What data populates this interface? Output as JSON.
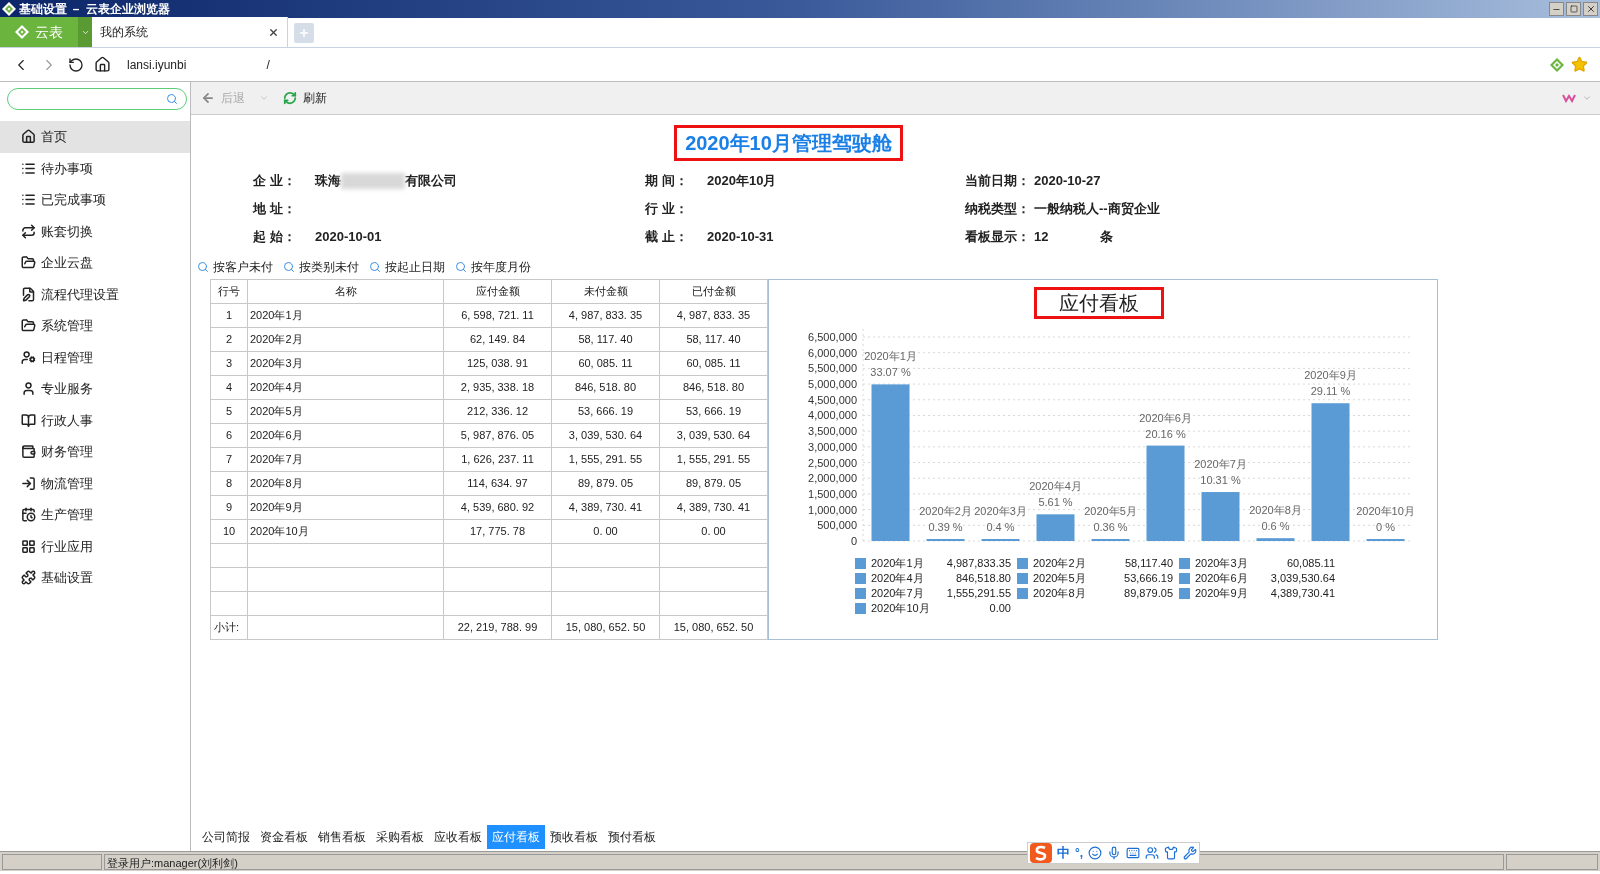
{
  "window": {
    "title": "基础设置 － 云表企业浏览器"
  },
  "browser": {
    "brand_button": "云表",
    "tabs": [
      {
        "label": "我的系统",
        "selected": true
      }
    ],
    "url_start": "lansi.iyunbi",
    "url_end": "/"
  },
  "toolbar": {
    "items": [
      {
        "label": "后退",
        "disabled": true,
        "kind": "back"
      },
      {
        "label": "刷新",
        "disabled": false,
        "kind": "refresh"
      }
    ]
  },
  "sidebar": {
    "items": [
      {
        "label": "首页",
        "selected": true,
        "kind": "home"
      },
      {
        "label": "待办事项",
        "selected": false,
        "kind": "list"
      },
      {
        "label": "已完成事项",
        "selected": false,
        "kind": "list"
      },
      {
        "label": "账套切换",
        "selected": false,
        "kind": "switch"
      },
      {
        "label": "企业云盘",
        "selected": false,
        "kind": "folder"
      },
      {
        "label": "流程代理设置",
        "selected": false,
        "kind": "edit"
      },
      {
        "label": "系统管理",
        "selected": false,
        "kind": "folder"
      },
      {
        "label": "日程管理",
        "selected": false,
        "kind": "usercard"
      },
      {
        "label": "专业服务",
        "selected": false,
        "kind": "user"
      },
      {
        "label": "行政人事",
        "selected": false,
        "kind": "book"
      },
      {
        "label": "财务管理",
        "selected": false,
        "kind": "wallet"
      },
      {
        "label": "物流管理",
        "selected": false,
        "kind": "login"
      },
      {
        "label": "生产管理",
        "selected": false,
        "kind": "clock"
      },
      {
        "label": "行业应用",
        "selected": false,
        "kind": "grid"
      },
      {
        "label": "基础设置",
        "selected": false,
        "kind": "puzzle"
      }
    ]
  },
  "page": {
    "title": "2020年10月管理驾驶舱",
    "info": [
      {
        "label": "企 业：",
        "value": "珠海",
        "value_after_redaction": "有限公司"
      },
      {
        "label": "期 间：",
        "value": "2020年10月"
      },
      {
        "label": "当前日期：",
        "value": "2020-10-27"
      },
      {
        "label": "地 址："
      },
      {
        "label": "行 业："
      },
      {
        "label": "纳税类型：",
        "value": "一般纳税人--商贸企业"
      },
      {
        "label": "起 始：",
        "value": "2020-10-01"
      },
      {
        "label": "截 止：",
        "value": "2020-10-31"
      },
      {
        "label": "看板显示：",
        "value": "12",
        "unit": "条"
      }
    ],
    "filters": [
      "按客户未付",
      "按类别未付",
      "按起止日期",
      "按年度月份"
    ],
    "table": {
      "columns": [
        "行号",
        "名称",
        "应付金额",
        "未付金额",
        "已付金额"
      ],
      "rows": [
        [
          "1",
          "2020年1月",
          "6, 598, 721. 11",
          "4, 987, 833. 35",
          "4, 987, 833. 35"
        ],
        [
          "2",
          "2020年2月",
          "62, 149. 84",
          "58, 117. 40",
          "58, 117. 40"
        ],
        [
          "3",
          "2020年3月",
          "125, 038. 91",
          "60, 085. 11",
          "60, 085. 11"
        ],
        [
          "4",
          "2020年4月",
          "2, 935, 338. 18",
          "846, 518. 80",
          "846, 518. 80"
        ],
        [
          "5",
          "2020年5月",
          "212, 336. 12",
          "53, 666. 19",
          "53, 666. 19"
        ],
        [
          "6",
          "2020年6月",
          "5, 987, 876. 05",
          "3, 039, 530. 64",
          "3, 039, 530. 64"
        ],
        [
          "7",
          "2020年7月",
          "1, 626, 237. 11",
          "1, 555, 291. 55",
          "1, 555, 291. 55"
        ],
        [
          "8",
          "2020年8月",
          "114, 634. 97",
          "89, 879. 05",
          "89, 879. 05"
        ],
        [
          "9",
          "2020年9月",
          "4, 539, 680. 92",
          "4, 389, 730. 41",
          "4, 389, 730. 41"
        ],
        [
          "10",
          "2020年10月",
          "17, 775. 78",
          "0. 00",
          "0. 00"
        ]
      ],
      "total": {
        "label": "小计:",
        "values": [
          "22, 219, 788. 99",
          "15, 080, 652. 50",
          "15, 080, 652. 50"
        ]
      }
    },
    "chart": {
      "title": "应付看板",
      "chart_data": {
        "type": "bar",
        "categories": [
          "2020年1月",
          "2020年2月",
          "2020年3月",
          "2020年4月",
          "2020年5月",
          "2020年6月",
          "2020年7月",
          "2020年8月",
          "2020年9月",
          "2020年10月"
        ],
        "series": [
          {
            "color": "#5b9bd5",
            "values": [
              4990000,
              60000,
              60000,
              850000,
              50000,
              3040000,
              1560000,
              90000,
              4390000,
              0
            ]
          }
        ],
        "ylim": [
          0,
          6500000
        ],
        "grid": true,
        "yticks": [
          {
            "value": 0,
            "label": "0"
          },
          {
            "value": 500000,
            "label": "500,000"
          },
          {
            "value": 1000000,
            "label": "1,000,000"
          },
          {
            "value": 1500000,
            "label": "1,500,000"
          },
          {
            "value": 2000000,
            "label": "2,000,000"
          },
          {
            "value": 2500000,
            "label": "2,500,000"
          },
          {
            "value": 3000000,
            "label": "3,000,000"
          },
          {
            "value": 3500000,
            "label": "3,500,000"
          },
          {
            "value": 4000000,
            "label": "4,000,000"
          },
          {
            "value": 4500000,
            "label": "4,500,000"
          },
          {
            "value": 5000000,
            "label": "5,000,000"
          },
          {
            "value": 5500000,
            "label": "5,500,000"
          },
          {
            "value": 6000000,
            "label": "6,000,000"
          },
          {
            "value": 6500000,
            "label": "6,500,000"
          }
        ],
        "value_labels": [
          "33.07 %",
          "0.39 %",
          "0.4 %",
          "5.61 %",
          "0.36 %",
          "20.16 %",
          "10.31 %",
          "0.6 %",
          "29.11 %",
          "0 %"
        ]
      },
      "legend": [
        {
          "name": "2020年1月",
          "value": "4,987,833.35"
        },
        {
          "name": "2020年2月",
          "value": "58,117.40"
        },
        {
          "name": "2020年3月",
          "value": "60,085.11"
        },
        {
          "name": "2020年4月",
          "value": "846,518.80"
        },
        {
          "name": "2020年5月",
          "value": "53,666.19"
        },
        {
          "name": "2020年6月",
          "value": "3,039,530.64"
        },
        {
          "name": "2020年7月",
          "value": "1,555,291.55"
        },
        {
          "name": "2020年8月",
          "value": "89,879.05"
        },
        {
          "name": "2020年9月",
          "value": "4,389,730.41"
        },
        {
          "name": "2020年10月",
          "value": "0.00"
        }
      ]
    }
  },
  "board_tabs": [
    {
      "label": "公司简报",
      "selected": false
    },
    {
      "label": "资金看板",
      "selected": false
    },
    {
      "label": "销售看板",
      "selected": false
    },
    {
      "label": "采购看板",
      "selected": false
    },
    {
      "label": "应收看板",
      "selected": false
    },
    {
      "label": "应付看板",
      "selected": true
    },
    {
      "label": "预收看板",
      "selected": false
    },
    {
      "label": "预付看板",
      "selected": false
    }
  ],
  "status_bar": {
    "user": "登录用户:manager(刘利剑)",
    "ime": {
      "mode": "中",
      "punct": "°,"
    }
  }
}
